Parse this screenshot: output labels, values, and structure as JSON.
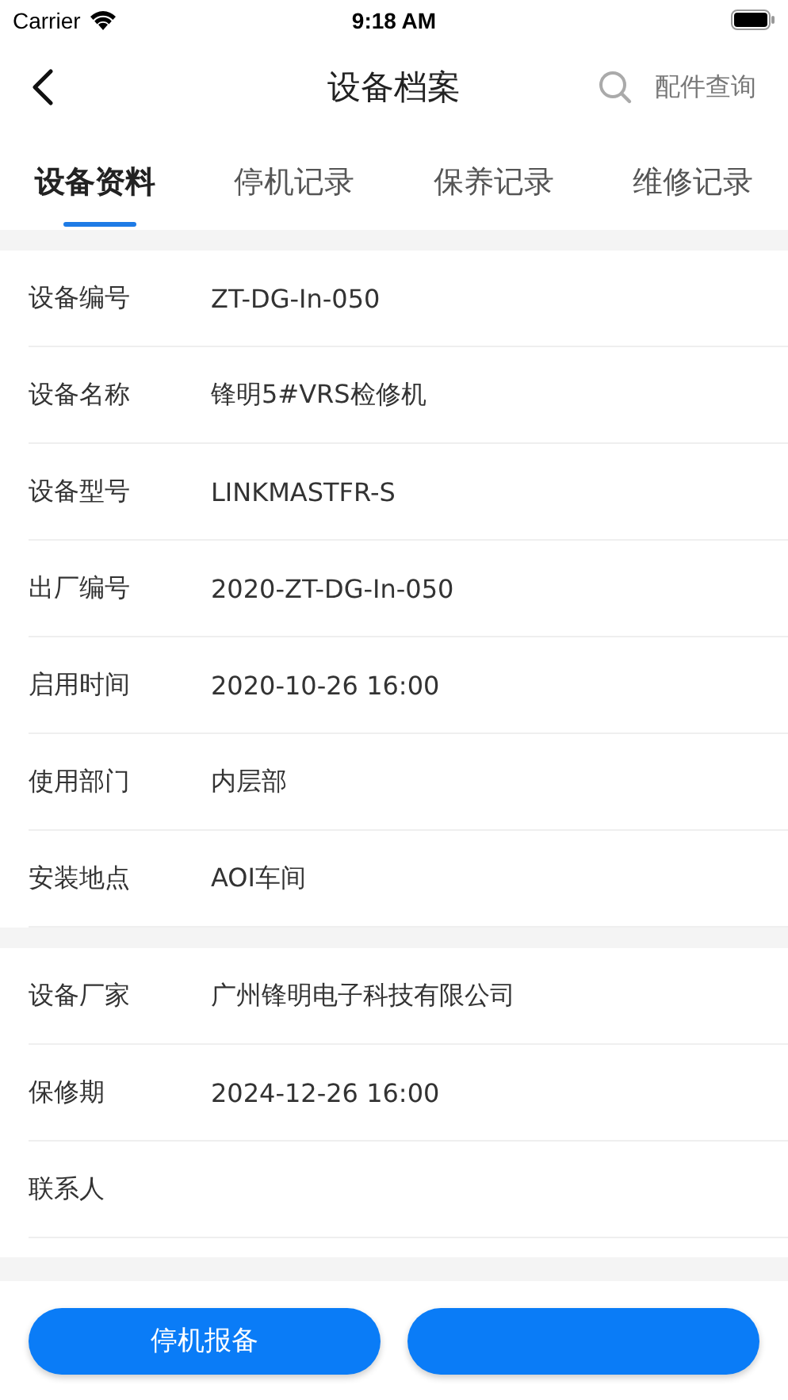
{
  "status_bar": {
    "carrier": "Carrier",
    "time": "9:18 AM"
  },
  "nav": {
    "title": "设备档案",
    "search_label": "配件查询"
  },
  "tabs": [
    {
      "label": "设备资料",
      "selected": true
    },
    {
      "label": "停机记录",
      "selected": false
    },
    {
      "label": "保养记录",
      "selected": false
    },
    {
      "label": "维修记录",
      "selected": false
    }
  ],
  "sections": [
    {
      "rows": [
        {
          "label": "设备编号",
          "value": "ZT-DG-In-050"
        },
        {
          "label": "设备名称",
          "value": "锋明5#VRS检修机"
        },
        {
          "label": "设备型号",
          "value": "LINKMASTFR-S"
        },
        {
          "label": "出厂编号",
          "value": "2020-ZT-DG-In-050"
        },
        {
          "label": "启用时间",
          "value": "2020-10-26 16:00"
        },
        {
          "label": "使用部门",
          "value": "内层部"
        },
        {
          "label": "安装地点",
          "value": "AOI车间"
        }
      ]
    },
    {
      "rows": [
        {
          "label": "设备厂家",
          "value": "广州锋明电子科技有限公司"
        },
        {
          "label": "保修期",
          "value": "2024-12-26 16:00"
        },
        {
          "label": "联系人"
        }
      ]
    }
  ],
  "buttons": [
    {
      "kind": "labeled",
      "label": "停机报备"
    },
    {
      "kind": "covered"
    }
  ]
}
